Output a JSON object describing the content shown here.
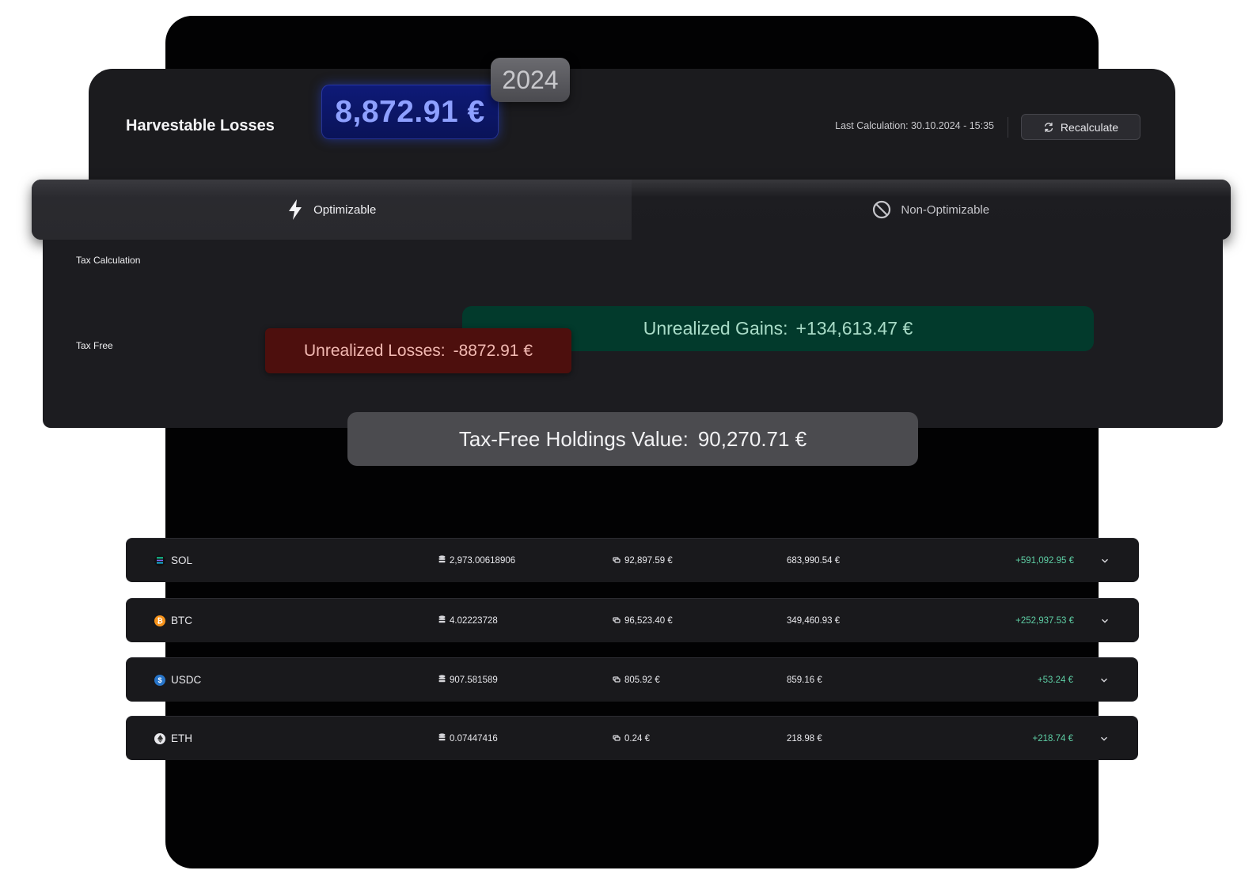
{
  "header": {
    "title": "Harvestable Losses",
    "amount": "8,872.91 €",
    "year": "2024",
    "last_calculation": "Last Calculation: 30.10.2024 - 15:35",
    "recalculate_label": "Recalculate"
  },
  "tabs": [
    {
      "label": "Optimizable",
      "icon": "lightning-icon",
      "active": true
    },
    {
      "label": "Non-Optimizable",
      "icon": "prohibited-icon",
      "active": false
    }
  ],
  "tax": {
    "calculation_label": "Tax Calculation",
    "tax_free_label": "Tax Free",
    "gains_label": "Unrealized Gains:",
    "gains_value": "+134,613.47 €",
    "losses_label": "Unrealized Losses:",
    "losses_value": "-8872.91 €",
    "holdings_label": "Tax-Free Holdings Value:",
    "holdings_value": "90,270.71 €"
  },
  "colors": {
    "gains_bg": "#023a2c",
    "losses_bg": "#4d0f0d",
    "positive_text": "#5ecfa5",
    "amount_text": "#8ea0ff"
  },
  "assets": [
    {
      "symbol": "SOL",
      "icon": "solana-icon",
      "quantity": "2,973.00618906",
      "price": "92,897.59 €",
      "value": "683,990.54 €",
      "gain": "+591,092.95 €"
    },
    {
      "symbol": "BTC",
      "icon": "bitcoin-icon",
      "quantity": "4.02223728",
      "price": "96,523.40 €",
      "value": "349,460.93 €",
      "gain": "+252,937.53 €"
    },
    {
      "symbol": "USDC",
      "icon": "usdc-icon",
      "quantity": "907.581589",
      "price": "805.92 €",
      "value": "859.16 €",
      "gain": "+53.24 €"
    },
    {
      "symbol": "ETH",
      "icon": "ethereum-icon",
      "quantity": "0.07447416",
      "price": "0.24 €",
      "value": "218.98 €",
      "gain": "+218.74 €"
    }
  ]
}
